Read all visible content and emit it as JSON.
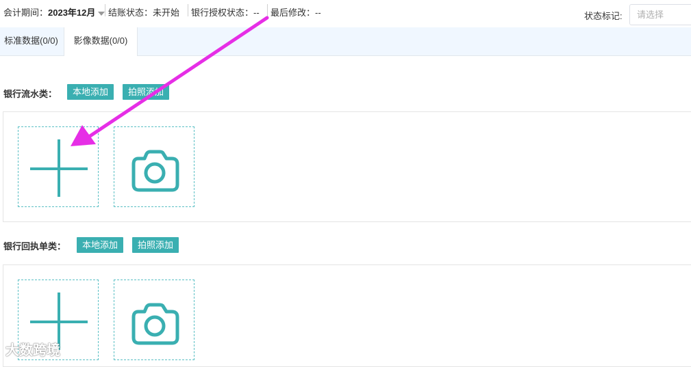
{
  "topbar": {
    "period_label": "会计期间：",
    "period_value": "2023年12月",
    "close_status": "结账状态：未开始",
    "bank_auth": "银行授权状态：--",
    "last_modified": "最后修改：--",
    "status_mark_label": "状态标记:",
    "status_mark_placeholder": "请选择"
  },
  "tabs": [
    {
      "label": "标准数据(0/0)"
    },
    {
      "label": "影像数据(0/0)"
    }
  ],
  "sections": [
    {
      "title": "银行流水类：",
      "local_add": "本地添加",
      "photo_add": "拍照添加"
    },
    {
      "title": "银行回执单类：",
      "local_add": "本地添加",
      "photo_add": "拍照添加"
    }
  ],
  "icons": {
    "add": "plus-icon",
    "camera": "camera-icon",
    "annotation": "magenta-arrow"
  },
  "colors": {
    "accent": "#3aafb1",
    "arrow": "#e62ee6",
    "tab_bg": "#f0f7ff"
  },
  "watermark": "大数跨境"
}
